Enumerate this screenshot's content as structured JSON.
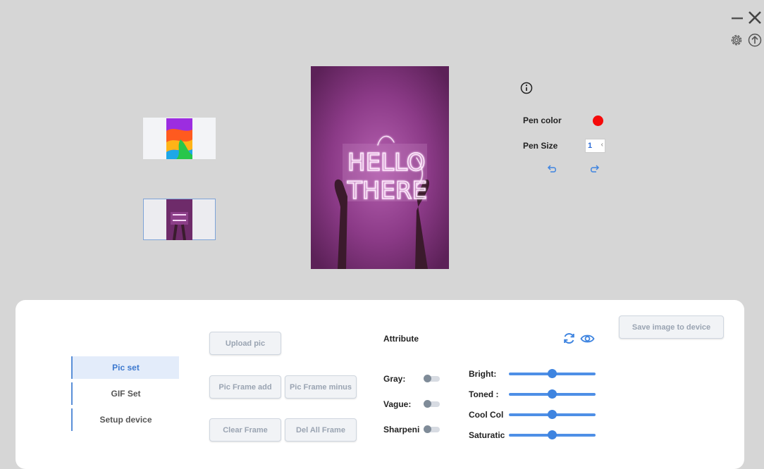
{
  "window": {
    "controls": [
      {
        "name": "minimize-icon"
      },
      {
        "name": "close-icon"
      },
      {
        "name": "gear-icon"
      },
      {
        "name": "upload-circle-icon"
      }
    ]
  },
  "thumbnails": [
    {
      "name": "thumbnail-abstract",
      "selected": false
    },
    {
      "name": "thumbnail-hello-there",
      "selected": true
    }
  ],
  "preview": {
    "neon_line1": "HELLO",
    "neon_line2": "THERE"
  },
  "right_panel": {
    "pen_color_label": "Pen color",
    "pen_color": "#f50a0a",
    "pen_size_label": "Pen Size",
    "pen_size_value": "1",
    "pen_size_arrow": "‹"
  },
  "sidebar": {
    "items": [
      {
        "label": "Pic set",
        "active": true
      },
      {
        "label": "GIF Set",
        "active": false
      },
      {
        "label": "Setup device",
        "active": false
      }
    ]
  },
  "buttons": {
    "upload_pic": "Upload pic",
    "pic_frame_add": "Pic Frame add",
    "pic_frame_minus": "Pic Frame minus",
    "clear_frame": "Clear Frame",
    "del_all_frame": "Del All Frame",
    "save_image": "Save image to device"
  },
  "attributes": {
    "title": "Attribute",
    "toggles": [
      {
        "label": "Gray:",
        "on": false
      },
      {
        "label": "Vague:",
        "on": false
      },
      {
        "label": "Sharpeni",
        "on": false
      }
    ],
    "sliders": [
      {
        "label": "Bright:",
        "value": 0.5
      },
      {
        "label": "Toned :",
        "value": 0.5
      },
      {
        "label": "Cool Col",
        "value": 0.5
      },
      {
        "label": "Saturatic",
        "value": 0.5
      }
    ]
  },
  "colors": {
    "accent": "#3e84e0",
    "background": "#d6d6d6",
    "preview_purple": "#7a3276"
  }
}
